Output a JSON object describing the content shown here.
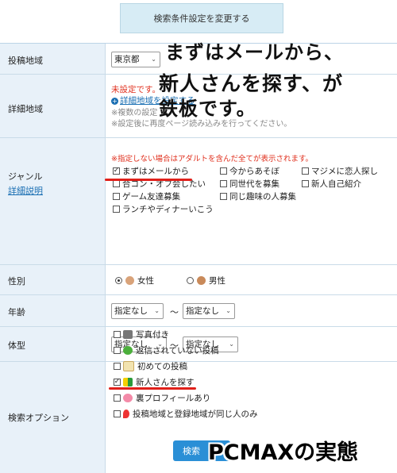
{
  "top": {
    "change_button": "検索条件設定を変更する"
  },
  "rows": {
    "area": {
      "label": "投稿地域",
      "select": "東京都"
    },
    "detail": {
      "label": "詳細地域",
      "unset": "未設定です。",
      "link": "詳細地域を設定する",
      "note1": "※複数の設定",
      "note2": "※設定後に再度ページ読み込みを行ってください。"
    },
    "genre": {
      "label": "ジャンル",
      "help_link": "詳細説明",
      "warning": "※指定しない場合はアダルトを含んだ全てが表示されます。",
      "items": [
        {
          "label": "まずはメールから",
          "checked": true
        },
        {
          "label": "今からあそぼ",
          "checked": false
        },
        {
          "label": "マジメに恋人探し",
          "checked": false
        },
        {
          "label": "合コン・オフ会したい",
          "checked": false
        },
        {
          "label": "同世代を募集",
          "checked": false
        },
        {
          "label": "新人自己紹介",
          "checked": false
        },
        {
          "label": "ゲーム友達募集",
          "checked": false
        },
        {
          "label": "同じ趣味の人募集",
          "checked": false
        },
        {
          "label": "ランチやディナーいこう",
          "checked": false
        }
      ]
    },
    "sex": {
      "label": "性別",
      "female": "女性",
      "male": "男性",
      "selected": "female"
    },
    "age": {
      "label": "年齢",
      "from": "指定なし",
      "to": "指定なし",
      "sep": "～"
    },
    "body": {
      "label": "体型",
      "from": "指定なし",
      "to": "指定なし",
      "sep": "～"
    },
    "options": {
      "label": "検索オプション",
      "items": [
        {
          "label": "写真付き",
          "icon": "camera-icon",
          "checked": false
        },
        {
          "label": "返信されていない投稿",
          "icon": "clover-icon",
          "checked": false
        },
        {
          "label": "初めての投稿",
          "icon": "memo-icon",
          "checked": false
        },
        {
          "label": "新人さんを探す",
          "icon": "beginner-mark-icon",
          "checked": true
        },
        {
          "label": "裏プロフィールあり",
          "icon": "heart-icon",
          "checked": false
        },
        {
          "label": "投稿地域と登録地域が同じ人のみ",
          "icon": "pin-icon",
          "checked": false
        }
      ]
    }
  },
  "search_button": "検索",
  "overlay": {
    "line1": "まずはメールから、",
    "line2": "新人さんを探す、が",
    "line3": "鉄板です。",
    "caption": "PCMAXの実態"
  },
  "colors": {
    "label_bg": "#e8f1f9",
    "accent_red": "#e0201a",
    "link_blue": "#1a6fb3",
    "button_blue": "#2a8fd6"
  }
}
